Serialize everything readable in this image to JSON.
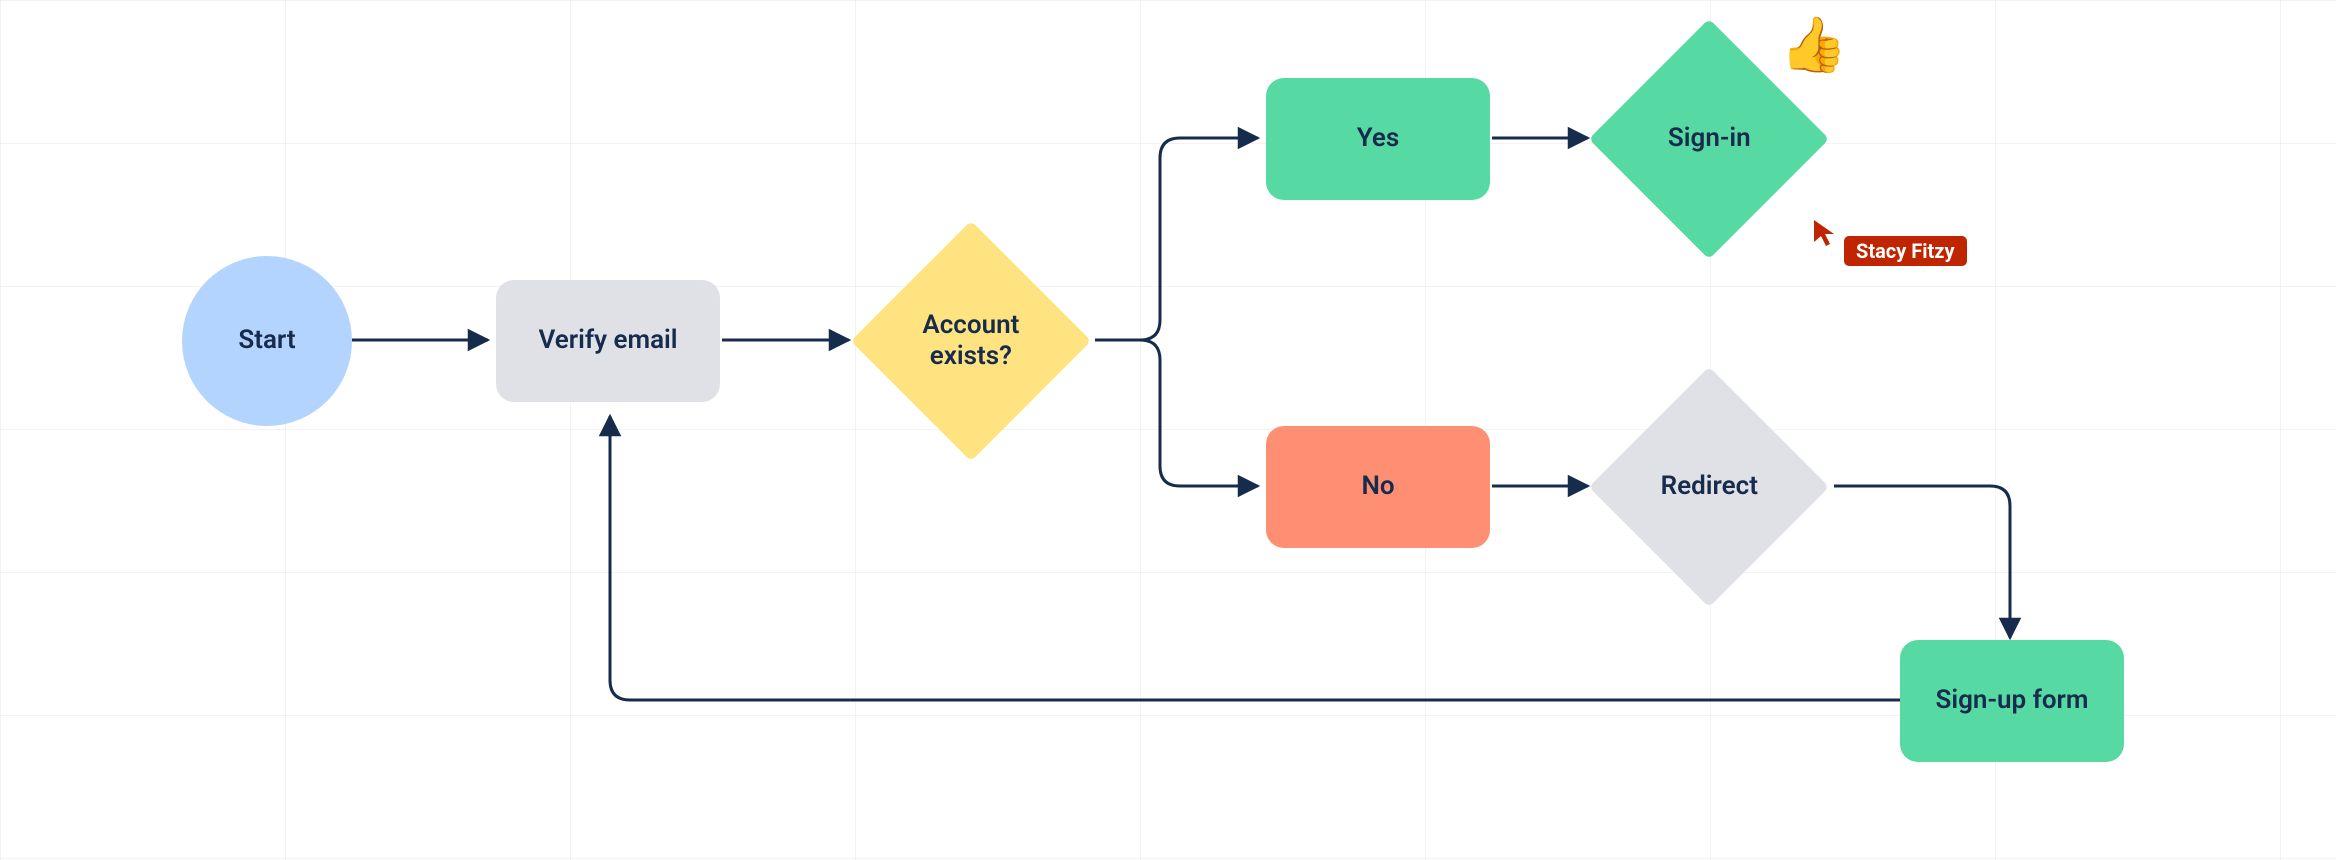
{
  "nodes": {
    "start": {
      "label": "Start"
    },
    "verify": {
      "label": "Verify email"
    },
    "decision": {
      "label": "Account exists?"
    },
    "yes": {
      "label": "Yes"
    },
    "no": {
      "label": "No"
    },
    "signin": {
      "label": "Sign-in"
    },
    "redirect": {
      "label": "Redirect"
    },
    "signup": {
      "label": "Sign-up form"
    }
  },
  "emoji": {
    "thumbsup": "👍"
  },
  "cursor": {
    "user": "Stacy Fitzy"
  },
  "colors": {
    "blue": "#B3D4FF",
    "grey": "#DFE1E6",
    "yellow": "#FFE380",
    "green": "#57D9A3",
    "red": "#FF8F73",
    "navy": "#172B4D",
    "badge": "#BF2600"
  },
  "chart_data": {
    "type": "flowchart",
    "nodes": [
      {
        "id": "start",
        "label": "Start",
        "shape": "circle",
        "color": "blue"
      },
      {
        "id": "verify",
        "label": "Verify email",
        "shape": "rect",
        "color": "grey"
      },
      {
        "id": "decision",
        "label": "Account exists?",
        "shape": "diamond",
        "color": "yellow"
      },
      {
        "id": "yes",
        "label": "Yes",
        "shape": "rect",
        "color": "green"
      },
      {
        "id": "no",
        "label": "No",
        "shape": "rect",
        "color": "red"
      },
      {
        "id": "signin",
        "label": "Sign-in",
        "shape": "diamond",
        "color": "green"
      },
      {
        "id": "redirect",
        "label": "Redirect",
        "shape": "diamond",
        "color": "grey"
      },
      {
        "id": "signup",
        "label": "Sign-up form",
        "shape": "rect",
        "color": "green"
      }
    ],
    "edges": [
      {
        "from": "start",
        "to": "verify"
      },
      {
        "from": "verify",
        "to": "decision"
      },
      {
        "from": "decision",
        "to": "yes"
      },
      {
        "from": "decision",
        "to": "no"
      },
      {
        "from": "yes",
        "to": "signin"
      },
      {
        "from": "no",
        "to": "redirect"
      },
      {
        "from": "redirect",
        "to": "signup"
      },
      {
        "from": "signup",
        "to": "verify"
      }
    ],
    "annotations": [
      {
        "type": "emoji",
        "value": "thumbs-up",
        "attached_to": "signin"
      },
      {
        "type": "user-cursor",
        "value": "Stacy Fitzy",
        "near": "signin"
      }
    ]
  }
}
